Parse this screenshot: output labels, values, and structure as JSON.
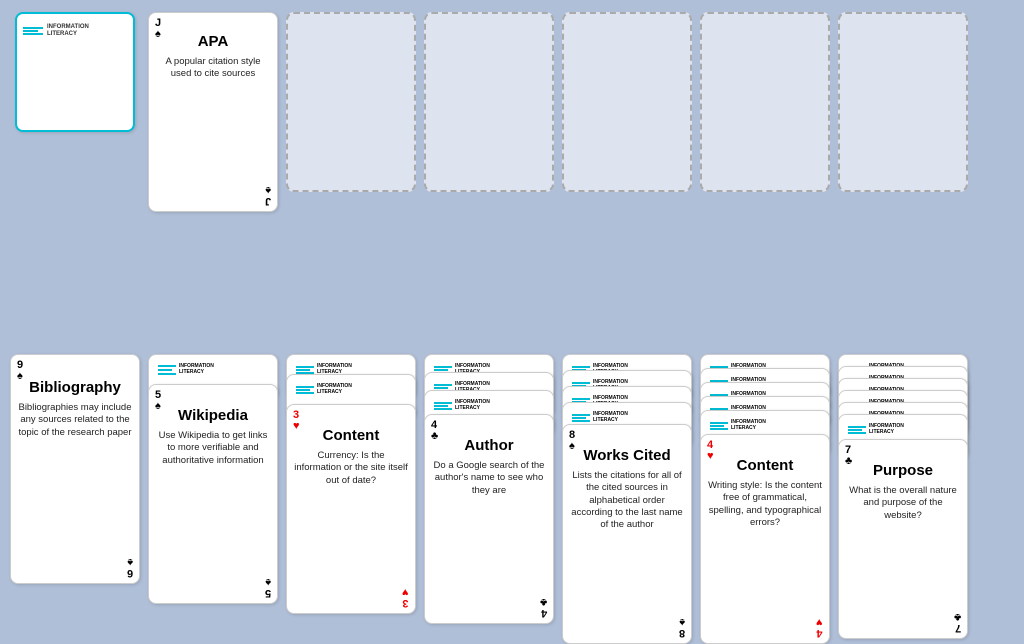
{
  "logo": {
    "line1": "INFORMATION",
    "line2": "LITERACY"
  },
  "columns": [
    {
      "id": "col0",
      "cards": [
        {
          "type": "logo-face-down",
          "tealBorder": true,
          "cornerTL": "",
          "cornerBR": "",
          "faceDown": false,
          "title": "",
          "body": ""
        }
      ]
    },
    {
      "id": "col1",
      "topCard": {
        "cornerTL": "J",
        "suitTL": "♠",
        "cornerBR": "J",
        "suitBR": "♠",
        "title": "APA",
        "suitClass": "suit-spade",
        "body": "A popular citation style used to cite sources"
      },
      "stackCount": 0
    },
    {
      "id": "col2-empty",
      "cards": []
    },
    {
      "id": "col3-empty",
      "cards": []
    },
    {
      "id": "col4-empty",
      "cards": []
    },
    {
      "id": "col5-empty",
      "cards": []
    },
    {
      "id": "col6-empty",
      "cards": []
    }
  ],
  "bottomRow": [
    {
      "id": "b0",
      "cornerTL": "9",
      "suitTL": "♠",
      "cornerBR": "6",
      "suitBR": "♠",
      "suitClass": "suit-spade",
      "title": "Bibliography",
      "body": "Bibliographies may include any sources related to the topic of the research paper",
      "stackCount": 0
    },
    {
      "id": "b1",
      "cornerTL": "5",
      "suitTL": "♠",
      "cornerBR": "5",
      "suitBR": "♠",
      "suitClass": "suit-spade",
      "title": "Wikipedia",
      "body": "Use Wikipedia to get links to more verifiable and authoritative information",
      "stackCount": 1
    },
    {
      "id": "b2",
      "cornerTL": "3",
      "suitTL": "♥",
      "cornerBR": "3",
      "suitBR": "♥",
      "suitClass": "suit-heart",
      "title": "Content",
      "body": "Currency: Is the information or the site itself out of date?",
      "stackCount": 2
    },
    {
      "id": "b3",
      "cornerTL": "4",
      "suitTL": "♣",
      "cornerBR": "4",
      "suitBR": "♣",
      "suitClass": "suit-club",
      "title": "Author",
      "body": "Do a Google search of the author's name to see who they are",
      "stackCount": 3
    },
    {
      "id": "b4",
      "cornerTL": "8",
      "suitTL": "♠",
      "cornerBR": "8",
      "suitBR": "♠",
      "suitClass": "suit-spade",
      "title": "Works Cited",
      "body": "Lists the citations for all of the cited sources in alphabetical order according to the last name of the author",
      "stackCount": 4
    },
    {
      "id": "b5",
      "cornerTL": "4",
      "suitTL": "♥",
      "cornerBR": "4",
      "suitBR": "♥",
      "suitClass": "suit-heart",
      "title": "Content",
      "body": "Writing style: Is the content free of grammatical, spelling, and typographical errors?",
      "stackCount": 5
    },
    {
      "id": "b6",
      "cornerTL": "7",
      "suitTL": "♣",
      "cornerBR": "7",
      "suitBR": "♣",
      "suitClass": "suit-club",
      "title": "Purpose",
      "body": "What is the overall nature and purpose of the website?",
      "stackCount": 6
    }
  ]
}
